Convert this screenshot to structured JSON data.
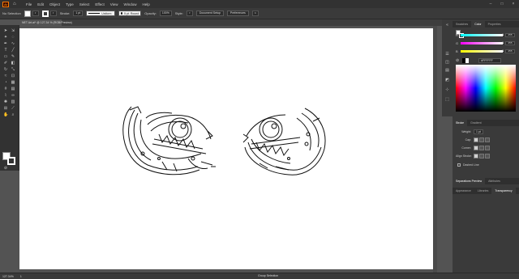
{
  "app": {
    "logo_text": "Ai",
    "menu": [
      "File",
      "Edit",
      "Object",
      "Type",
      "Select",
      "Effect",
      "View",
      "Window",
      "Help"
    ]
  },
  "control_bar": {
    "selection": "No Selection",
    "stroke_label": "Stroke:",
    "stroke_weight": "1 pt",
    "stroke_profile": "Uniform",
    "brush": "5 pt. Round",
    "opacity_label": "Opacity:",
    "opacity_value": "100%",
    "style_label": "Style:",
    "document_setup": "Document Setup",
    "preferences": "Preferences"
  },
  "document": {
    "tab_title": "NET Art.ai* @ 127.34 % (RGB/Preview)",
    "zoom": "127.34%",
    "page": "1",
    "status": "Group Selection"
  },
  "panels": {
    "top_tabs": [
      "Swatches",
      "Color",
      "Properties"
    ],
    "active_top_tab": "Color",
    "color": {
      "channels": [
        {
          "label": "R",
          "value": "255",
          "fraction": 1.0,
          "gradient": "linear-gradient(to right,#00ffff,#ffffff)"
        },
        {
          "label": "G",
          "value": "255",
          "fraction": 1.0,
          "gradient": "linear-gradient(to right,#ff00ff,#ffffff)"
        },
        {
          "label": "B",
          "value": "255",
          "fraction": 1.0,
          "gradient": "linear-gradient(to right,#ffff00,#ffffff)"
        }
      ],
      "hex": "FFFFFF"
    },
    "stroke_tabs": [
      "Stroke",
      "Gradient"
    ],
    "stroke": {
      "weight_label": "Weight:",
      "weight_value": "1 pt",
      "cap_label": "Cap:",
      "corner_label": "Corner:",
      "align_label": "Align Stroke:",
      "dashed_label": "Dashed Line"
    },
    "lower_tabs": [
      "Separations Preview",
      "Attributes"
    ],
    "bottom_tabs": [
      "Appearance",
      "Libraries",
      "Transparency"
    ],
    "active_bottom_tab": "Transparency"
  },
  "colors": {
    "ui_dark": "#323232",
    "ui_mid": "#3a3a3a",
    "canvas": "#535353",
    "artboard": "#ffffff",
    "accent": "#ff7c00"
  }
}
